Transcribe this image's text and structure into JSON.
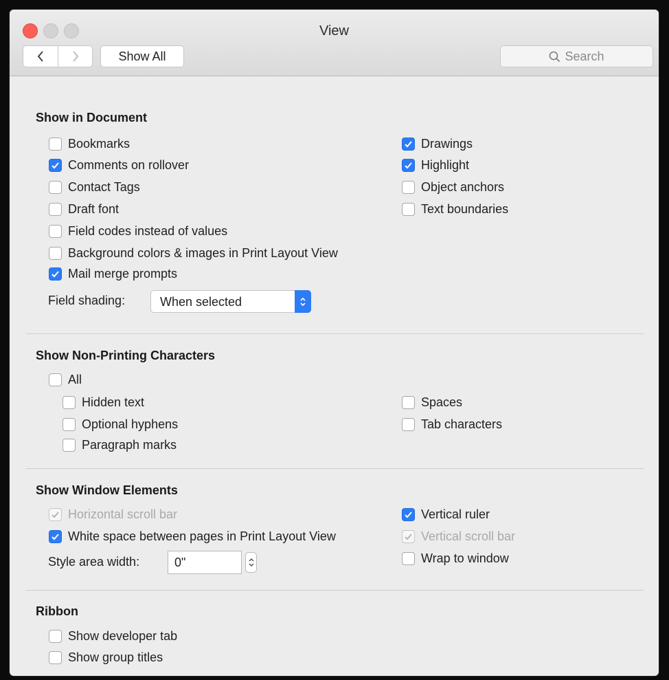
{
  "window": {
    "title": "View"
  },
  "toolbar": {
    "show_all": "Show All",
    "search_placeholder": "Search"
  },
  "sections": {
    "show_in_document": {
      "title": "Show in Document",
      "bookmarks": "Bookmarks",
      "comments_on_rollover": "Comments on rollover",
      "contact_tags": "Contact Tags",
      "draft_font": "Draft font",
      "field_codes": "Field codes instead of values",
      "background_colors": "Background colors & images in Print Layout View",
      "mail_merge": "Mail merge prompts",
      "drawings": "Drawings",
      "highlight": "Highlight",
      "object_anchors": "Object anchors",
      "text_boundaries": "Text boundaries",
      "field_shading_label": "Field shading:",
      "field_shading_value": "When selected"
    },
    "non_printing": {
      "title": "Show Non-Printing Characters",
      "all": "All",
      "hidden_text": "Hidden text",
      "optional_hyphens": "Optional hyphens",
      "paragraph_marks": "Paragraph marks",
      "spaces": "Spaces",
      "tab_characters": "Tab characters"
    },
    "window_elements": {
      "title": "Show Window Elements",
      "horizontal_scroll_bar": "Horizontal scroll bar",
      "white_space": "White space between pages in Print Layout View",
      "style_area_label": "Style area width:",
      "style_area_value": "0\"",
      "vertical_ruler": "Vertical ruler",
      "vertical_scroll_bar": "Vertical scroll bar",
      "wrap_to_window": "Wrap to window"
    },
    "ribbon": {
      "title": "Ribbon",
      "developer_tab": "Show developer tab",
      "group_titles": "Show group titles"
    }
  },
  "state": {
    "checked": [
      "comments_on_rollover",
      "mail_merge",
      "drawings",
      "highlight",
      "white_space",
      "vertical_ruler"
    ],
    "checked_disabled": [
      "horizontal_scroll_bar",
      "vertical_scroll_bar"
    ]
  },
  "colors": {
    "accent": "#2d7cf6",
    "close_button": "#fc5f57"
  }
}
